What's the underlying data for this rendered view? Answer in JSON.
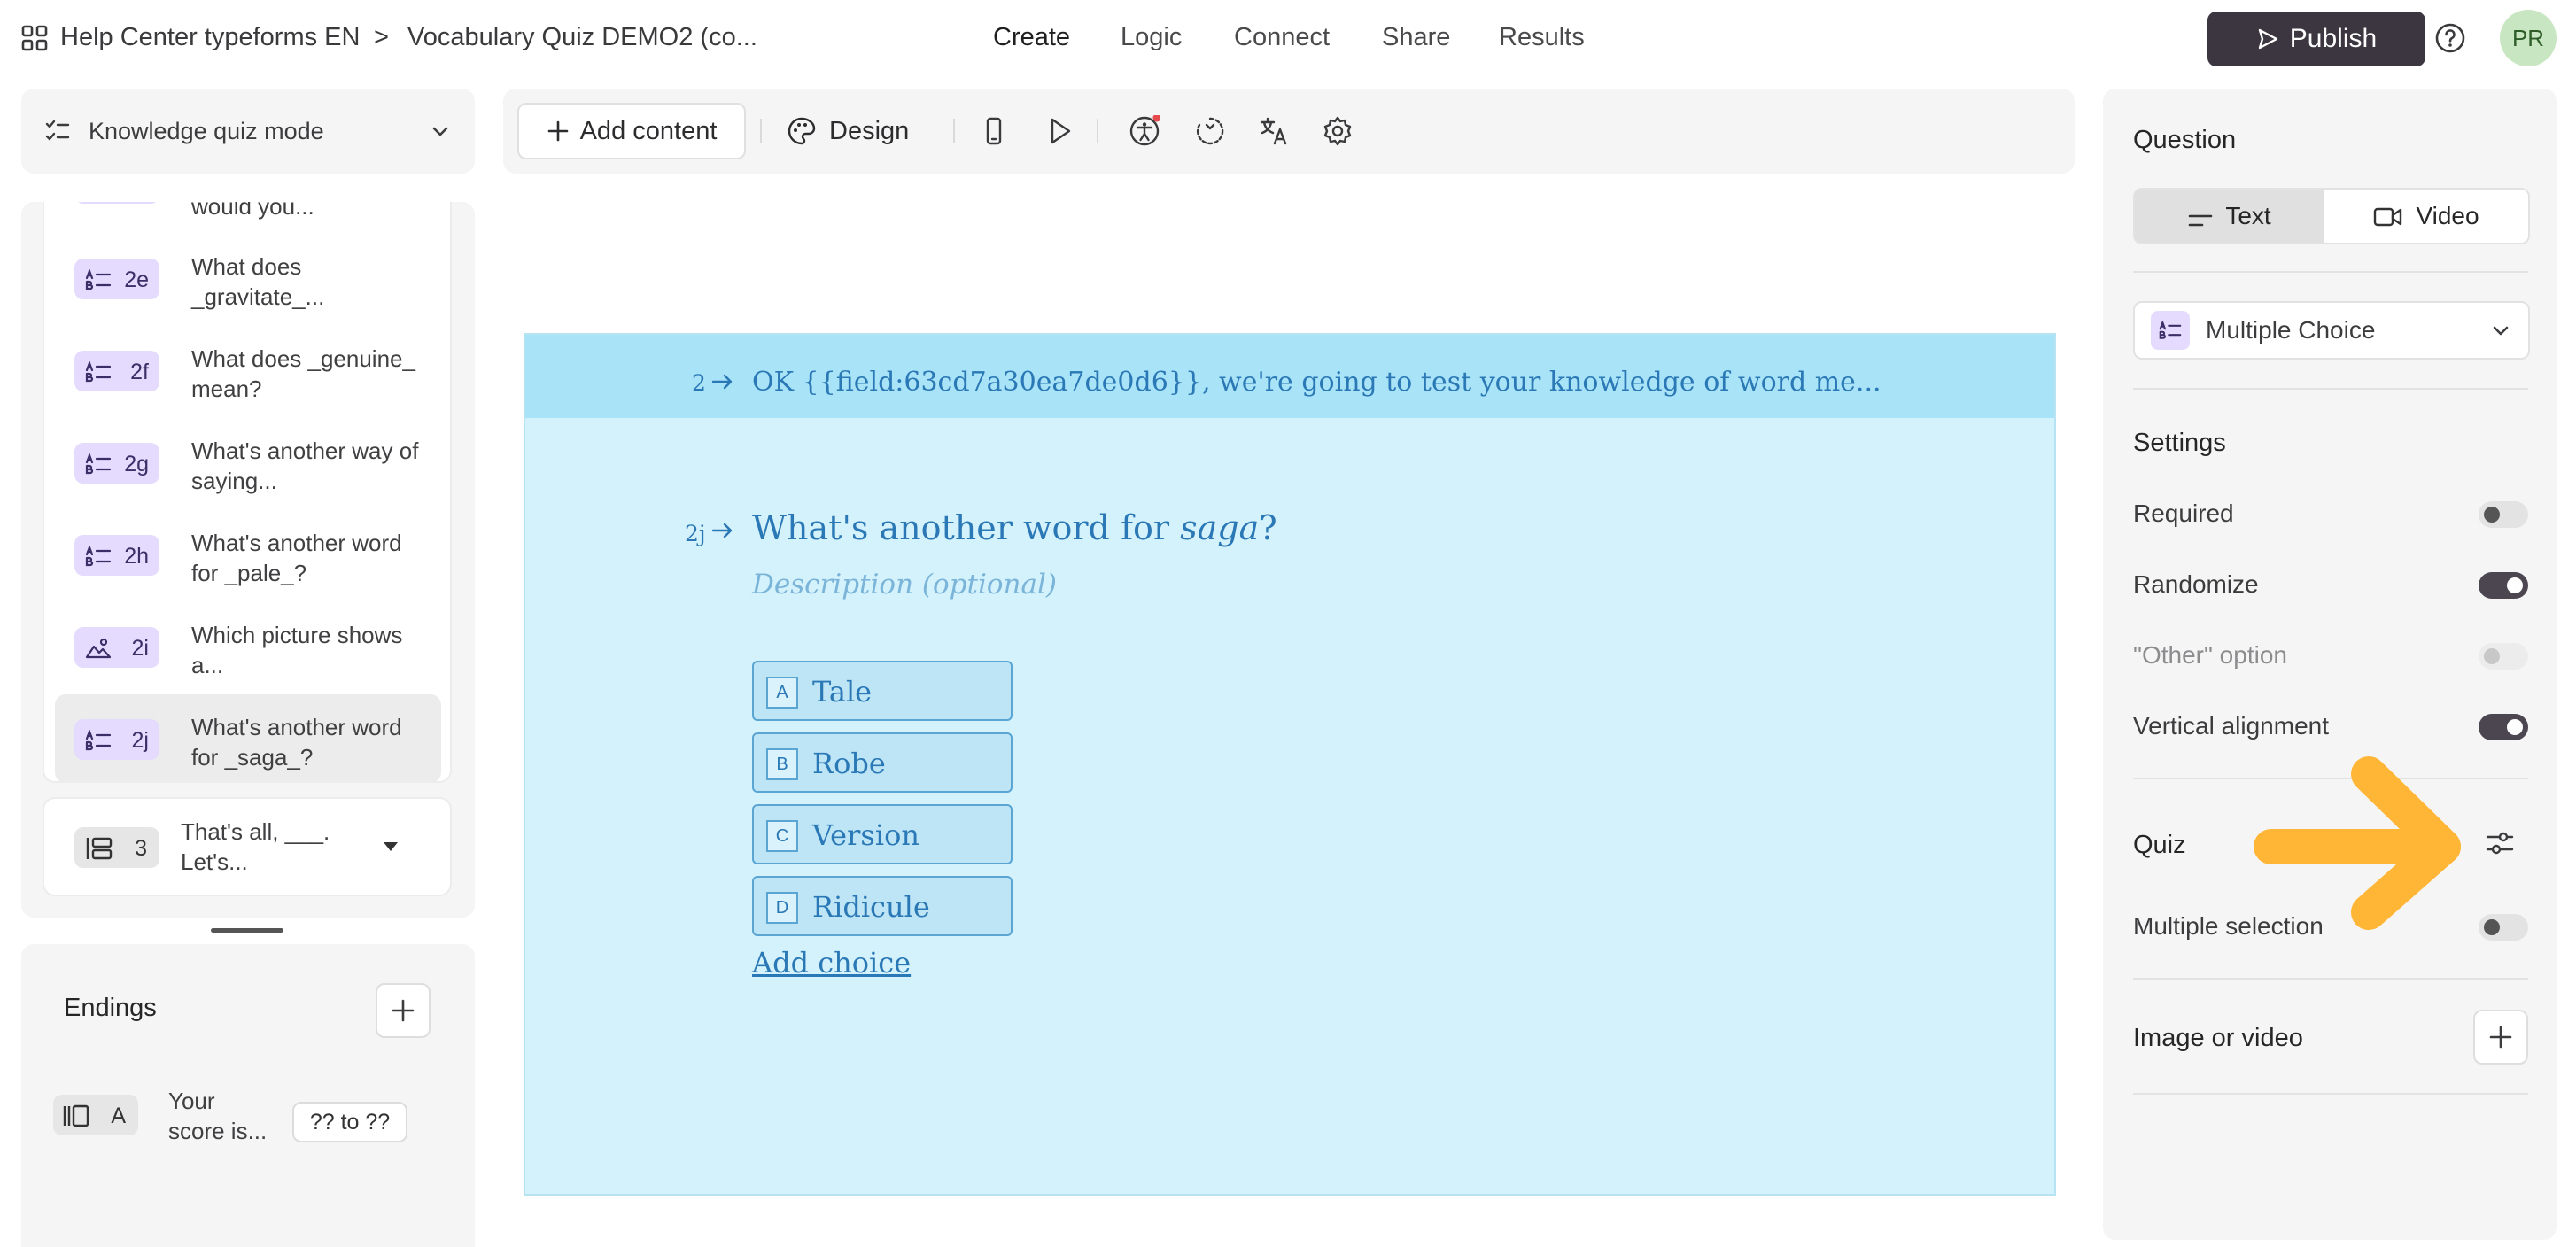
{
  "header": {
    "workspace": "Help Center typeforms EN",
    "separator": ">",
    "form_title": "Vocabulary Quiz DEMO2 (co...",
    "tabs": [
      {
        "label": "Create",
        "active": true
      },
      {
        "label": "Logic",
        "active": false
      },
      {
        "label": "Connect",
        "active": false
      },
      {
        "label": "Share",
        "active": false
      },
      {
        "label": "Results",
        "active": false
      }
    ],
    "publish_label": "Publish",
    "avatar_initials": "PR"
  },
  "left_panel": {
    "mode_label": "Knowledge quiz mode",
    "partial_item_text": "would you...",
    "questions": [
      {
        "num": "2e",
        "text": "What does _gravitate_...",
        "icon": "multiple-choice-icon",
        "selected": false
      },
      {
        "num": "2f",
        "text": "What does _genuine_ mean?",
        "icon": "multiple-choice-icon",
        "selected": false
      },
      {
        "num": "2g",
        "text": "What's another way of saying...",
        "icon": "multiple-choice-icon",
        "selected": false
      },
      {
        "num": "2h",
        "text": "What's another word for _pale_?",
        "icon": "multiple-choice-icon",
        "selected": false
      },
      {
        "num": "2i",
        "text": "Which picture shows a...",
        "icon": "picture-choice-icon",
        "selected": false
      },
      {
        "num": "2j",
        "text": "What's another word for _saga_?",
        "icon": "multiple-choice-icon",
        "selected": true
      }
    ],
    "group_item": {
      "num": "3",
      "text": "That's all, ___. Let's..."
    },
    "endings_title": "Endings",
    "ending": {
      "letter": "A",
      "text": "Your score is...",
      "range": "?? to ??"
    }
  },
  "toolbar": {
    "add_content_label": "Add content",
    "design_label": "Design"
  },
  "canvas": {
    "header_num": "2",
    "header_text": "OK {{field:63cd7a30ea7de0d6}}, we're going to test your knowledge of word me...",
    "question_num": "2j",
    "question_prefix": "What's another word for ",
    "question_emphasis": "saga",
    "question_suffix": "?",
    "description_placeholder": "Description (optional)",
    "choices": [
      {
        "key": "A",
        "label": "Tale"
      },
      {
        "key": "B",
        "label": "Robe"
      },
      {
        "key": "C",
        "label": "Version"
      },
      {
        "key": "D",
        "label": "Ridicule"
      }
    ],
    "add_choice_label": "Add choice",
    "colors": {
      "background": "#d4f2fc",
      "header": "#a9e3f7",
      "text": "#2a78b5"
    }
  },
  "right_panel": {
    "question_title": "Question",
    "text_tab": "Text",
    "video_tab": "Video",
    "question_type": "Multiple Choice",
    "settings_title": "Settings",
    "settings": [
      {
        "label": "Required",
        "state": "off"
      },
      {
        "label": "Randomize",
        "state": "on"
      },
      {
        "label": "\"Other\" option",
        "state": "disabled"
      },
      {
        "label": "Vertical alignment",
        "state": "on"
      }
    ],
    "quiz_title": "Quiz",
    "multiple_selection_label": "Multiple selection",
    "multiple_selection_state": "off",
    "image_video_label": "Image or video",
    "arrow_color": "#ffb636"
  }
}
